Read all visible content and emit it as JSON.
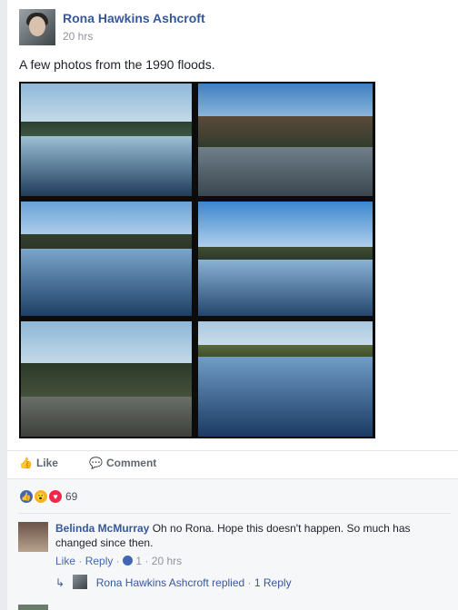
{
  "post": {
    "author": "Rona Hawkins Ashcroft",
    "time": "20 hrs",
    "text": "A few photos from the 1990 floods."
  },
  "actions": {
    "like_label": "Like",
    "comment_label": "Comment"
  },
  "reactions": {
    "icons": [
      "like-reaction-icon",
      "wow-reaction-icon",
      "love-reaction-icon"
    ],
    "count": "69",
    "colors": {
      "like": "#4267b2",
      "wow": "#f7b125",
      "love": "#f0284a"
    }
  },
  "comment": {
    "author": "Belinda McMurray",
    "text": "Oh no Rona. Hope this doesn't happen. So much has changed since then.",
    "like_label": "Like",
    "reply_label": "Reply",
    "like_count": "1",
    "time": "20 hrs",
    "separator": "·",
    "replies_author": "Rona Hawkins Ashcroft",
    "replies_label": "replied",
    "replies_count": "1 Reply"
  },
  "colors": {
    "link": "#365899",
    "meta": "#90949c",
    "page_bg": "#e9ebee"
  }
}
